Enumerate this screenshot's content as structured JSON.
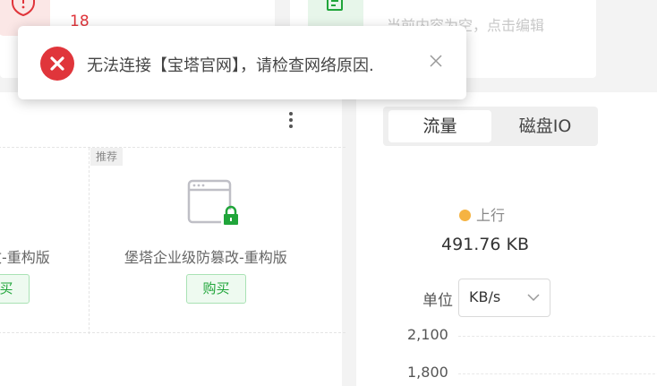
{
  "top_cards": {
    "warning_count": "18",
    "empty_hint": "当前内容为空，点击编辑"
  },
  "products": {
    "recommend_tag": "推荐",
    "items": [
      {
        "name": "改-重构版",
        "buy_label": "购买"
      },
      {
        "name": "堡塔企业级防篡改-重构版",
        "buy_label": "购买"
      }
    ]
  },
  "traffic": {
    "tabs": [
      "流量",
      "磁盘IO"
    ],
    "active_tab": "流量",
    "legend": "上行",
    "legend_color": "#f5b342",
    "value": "491.76 KB",
    "unit_label": "单位",
    "unit_selected": "KB/s",
    "y_ticks": [
      "2,100",
      "1,800"
    ]
  },
  "toast": {
    "message": "无法连接【宝塔官网】，请检查网络原因.",
    "type": "error",
    "error_color": "#e0353b"
  },
  "icons": {
    "warning": "warning-icon",
    "document": "document-icon",
    "error": "error-circle-icon",
    "close": "close-icon",
    "more": "more-vertical-icon",
    "tamper": "browser-lock-icon",
    "dropdown": "chevron-down-icon"
  }
}
